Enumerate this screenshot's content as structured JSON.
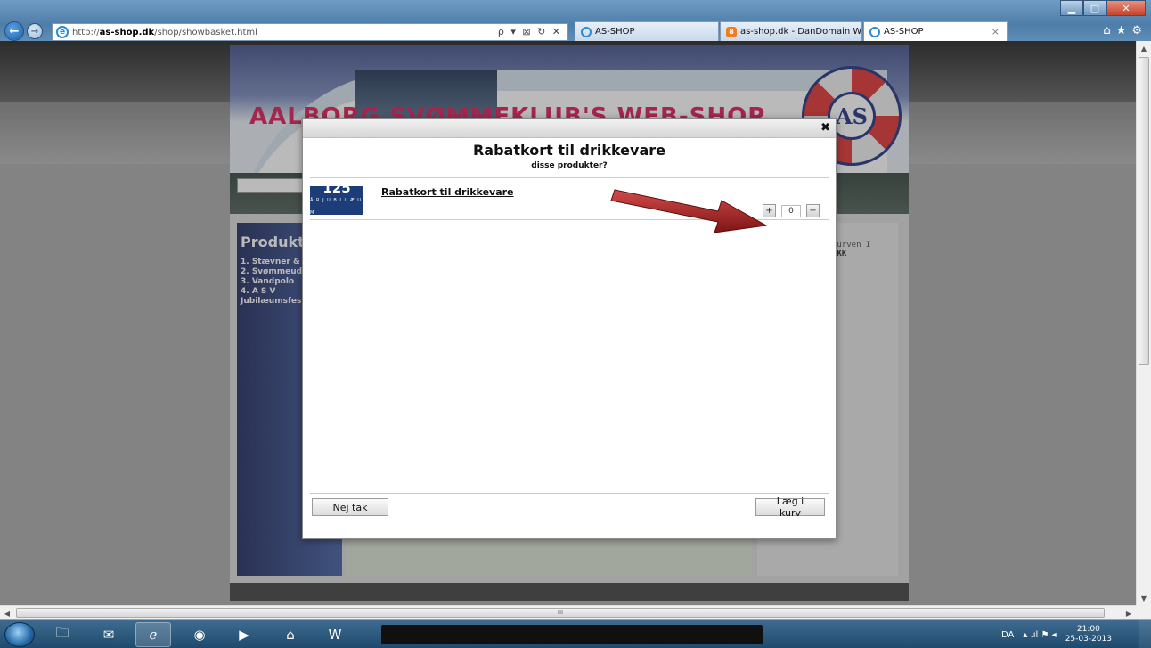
{
  "browser": {
    "url_prefix": "http://",
    "url_domain": "as-shop.dk",
    "url_path": "/shop/showbasket.html",
    "address_controls": "ρ ▾ ⊠ ↻ ✕",
    "tabs": [
      {
        "label": "AS-SHOP"
      },
      {
        "label": "as-shop.dk - DanDomain Web..."
      },
      {
        "label": "AS-SHOP"
      }
    ],
    "tab_close": "×",
    "back": "←",
    "forward": "→",
    "window_controls": {
      "minimize": "▁",
      "maximize": "□",
      "close": "✕"
    },
    "toolbar_icons": {
      "home": "⌂",
      "favorites": "★",
      "tools": "⚙"
    }
  },
  "site": {
    "title": "AALBORG SVØMMEKLUB'S WEB-SHOP",
    "logo_text": "AS",
    "sidebar_title": "Produkt",
    "sidebar_items": [
      "1. Stævner &",
      "2. Svømmeud",
      "3. Vandpolo",
      "4. A S V",
      "Jubilæumsfes"
    ],
    "basket_text_1": "kurven I",
    "basket_text_2": "DKK"
  },
  "modal": {
    "close": "✖",
    "title": "Rabatkort til drikkevare",
    "subtitle": "disse produkter?",
    "product": {
      "name": "Rabatkort til drikkevare",
      "thumb_text": "125",
      "thumb_small": "Å R J U B I L Æ U M",
      "quantity": "0",
      "plus": "+",
      "minus": "−"
    },
    "btn_no": "Nej tak",
    "btn_add": "Læg i kurv"
  },
  "scrollbars": {
    "up": "▲",
    "down": "▼",
    "left": "◀",
    "right": "▶",
    "grip": "III"
  },
  "taskbar": {
    "language": "DA",
    "tray_icons": "▴ .ıl ⚑ ◂",
    "time": "21:00",
    "date": "25-03-2013"
  },
  "colors": {
    "title_pink": "#e0265f",
    "arrow_red": "#a41f1f",
    "sidebar_blue": "#2b3768"
  }
}
